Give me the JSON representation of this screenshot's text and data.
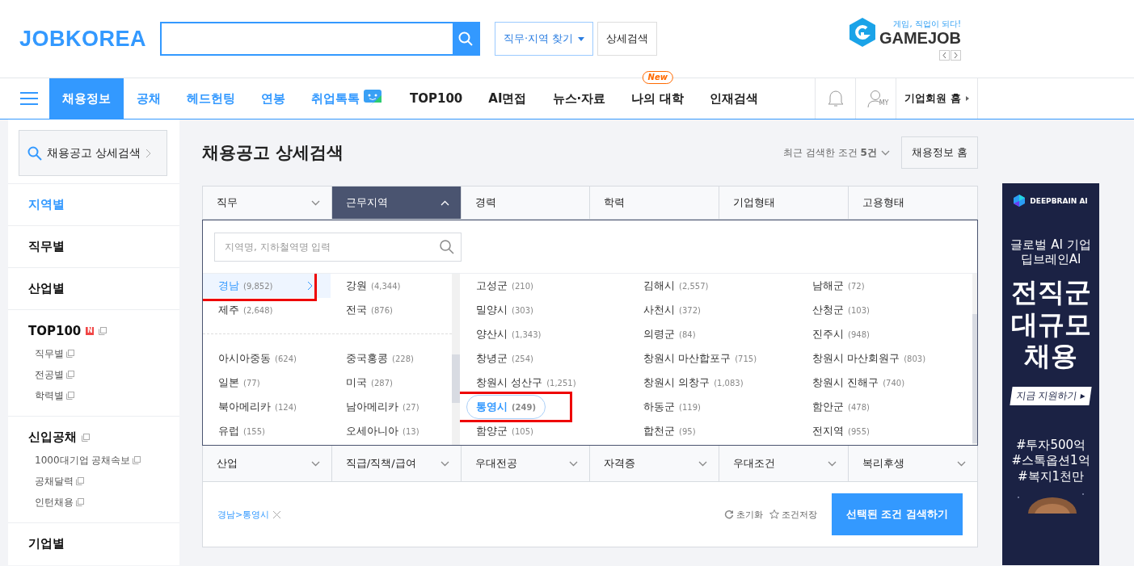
{
  "header": {
    "logo": "JOBKOREA",
    "find_button": "직무·지역 찾기",
    "detail_button": "상세검색",
    "promo": {
      "tagline": "게임, 직업이 되다!",
      "name": "GAMEJOB"
    }
  },
  "nav": {
    "items": [
      {
        "label": "채용정보",
        "selected": true
      },
      {
        "label": "공채",
        "selected": false
      },
      {
        "label": "헤드헌팅",
        "selected": false
      },
      {
        "label": "연봉",
        "selected": false
      },
      {
        "label": "취업톡톡",
        "selected": false,
        "kind": "chat"
      },
      {
        "label": "TOP100",
        "selected": false,
        "kind": "dark"
      },
      {
        "label": "AI면접",
        "selected": false,
        "kind": "dark"
      },
      {
        "label": "뉴스·자료",
        "selected": false,
        "kind": "dark"
      },
      {
        "label": "나의 대학",
        "selected": false,
        "kind": "dark",
        "badge": "New"
      },
      {
        "label": "인재검색",
        "selected": false,
        "kind": "dark"
      }
    ],
    "my_label": "MY",
    "company_home": "기업회원 홈"
  },
  "sidebar": {
    "search": "채용공고 상세검색",
    "sections": [
      {
        "label": "지역별",
        "selected": true
      },
      {
        "label": "직무별",
        "selected": false
      },
      {
        "label": "산업별",
        "selected": false
      },
      {
        "label": "TOP100",
        "selected": false,
        "badge": "N",
        "children": [
          {
            "label": "직무별"
          },
          {
            "label": "전공별"
          },
          {
            "label": "학력별"
          }
        ]
      },
      {
        "label": "신입공채",
        "selected": false,
        "children": [
          {
            "label": "1000대기업 공채속보"
          },
          {
            "label": "공채달력"
          },
          {
            "label": "인턴채용"
          }
        ]
      },
      {
        "label": "기업별",
        "selected": false
      }
    ]
  },
  "main": {
    "title": "채용공고 상세검색",
    "recent": "최근 검색한 조건 **5건**",
    "home_button": "채용정보 홈",
    "tabs": [
      {
        "label": "직무",
        "selected": false,
        "chevron": true
      },
      {
        "label": "근무지역",
        "selected": true,
        "chevron": true
      },
      {
        "label": "경력",
        "selected": false,
        "chevron": false
      },
      {
        "label": "학력",
        "selected": false,
        "chevron": false
      },
      {
        "label": "기업형태",
        "selected": false,
        "chevron": false
      },
      {
        "label": "고용형태",
        "selected": false,
        "chevron": false
      }
    ],
    "region_search": {
      "placeholder": "지역명, 지하철역명 입력"
    },
    "provinces": [
      {
        "name": "경남",
        "count": "(9,852)",
        "selected": true,
        "highlighted": true
      },
      {
        "name": "강원",
        "count": "(4,344)",
        "selected": false,
        "highlighted": false
      },
      {
        "name": "제주",
        "count": "(2,648)",
        "selected": false,
        "highlighted": false
      },
      {
        "name": "전국",
        "count": "(876)",
        "selected": false,
        "highlighted": false
      }
    ],
    "overseas": [
      {
        "name": "아시아중동",
        "count": "(624)"
      },
      {
        "name": "중국홍콩",
        "count": "(228)"
      },
      {
        "name": "일본",
        "count": "(77)"
      },
      {
        "name": "미국",
        "count": "(287)"
      },
      {
        "name": "북아메리카",
        "count": "(124)"
      },
      {
        "name": "남아메리카",
        "count": "(27)"
      },
      {
        "name": "유럽",
        "count": "(155)"
      },
      {
        "name": "오세아니아",
        "count": "(13)"
      }
    ],
    "cities": [
      {
        "name": "고성군",
        "count": "(210)",
        "selected": false,
        "highlighted": false
      },
      {
        "name": "김해시",
        "count": "(2,557)",
        "selected": false,
        "highlighted": false
      },
      {
        "name": "남해군",
        "count": "(72)",
        "selected": false,
        "highlighted": false
      },
      {
        "name": "밀양시",
        "count": "(303)",
        "selected": false,
        "highlighted": false
      },
      {
        "name": "사천시",
        "count": "(372)",
        "selected": false,
        "highlighted": false
      },
      {
        "name": "산청군",
        "count": "(103)",
        "selected": false,
        "highlighted": false
      },
      {
        "name": "양산시",
        "count": "(1,343)",
        "selected": false,
        "highlighted": false
      },
      {
        "name": "의령군",
        "count": "(84)",
        "selected": false,
        "highlighted": false
      },
      {
        "name": "진주시",
        "count": "(948)",
        "selected": false,
        "highlighted": false
      },
      {
        "name": "창녕군",
        "count": "(254)",
        "selected": false,
        "highlighted": false
      },
      {
        "name": "창원시 마산합포구",
        "count": "(715)",
        "selected": false,
        "highlighted": false
      },
      {
        "name": "창원시 마산회원구",
        "count": "(803)",
        "selected": false,
        "highlighted": false
      },
      {
        "name": "창원시 성산구",
        "count": "(1,251)",
        "selected": false,
        "highlighted": false
      },
      {
        "name": "창원시 의창구",
        "count": "(1,083)",
        "selected": false,
        "highlighted": false
      },
      {
        "name": "창원시 진해구",
        "count": "(740)",
        "selected": false,
        "highlighted": false
      },
      {
        "name": "통영시",
        "count": "(249)",
        "selected": true,
        "highlighted": true
      },
      {
        "name": "하동군",
        "count": "(119)",
        "selected": false,
        "highlighted": false
      },
      {
        "name": "함안군",
        "count": "(478)",
        "selected": false,
        "highlighted": false
      },
      {
        "name": "함양군",
        "count": "(105)",
        "selected": false,
        "highlighted": false
      },
      {
        "name": "합천군",
        "count": "(95)",
        "selected": false,
        "highlighted": false
      },
      {
        "name": "전지역",
        "count": "(955)",
        "selected": false,
        "highlighted": false
      }
    ],
    "bottom_tabs": [
      {
        "label": "산업"
      },
      {
        "label": "직급/직책/급여"
      },
      {
        "label": "우대전공"
      },
      {
        "label": "자격증"
      },
      {
        "label": "우대조건"
      },
      {
        "label": "복리후생"
      }
    ],
    "selected_tag": "경남>통영시",
    "reset": "초기화",
    "save": "조건저장",
    "submit": "선택된 조건 검색하기"
  },
  "ad": {
    "brand": "DEEPBRAIN AI",
    "subtitle": [
      "글로벌 AI 기업",
      "딥브레인AI"
    ],
    "headline": [
      "전직군",
      "대규모",
      "채용"
    ],
    "cta": "지금 지원하기 ▸",
    "tags": [
      "#투자500억",
      "#스톡옵션1억",
      "#복지1천만"
    ]
  }
}
